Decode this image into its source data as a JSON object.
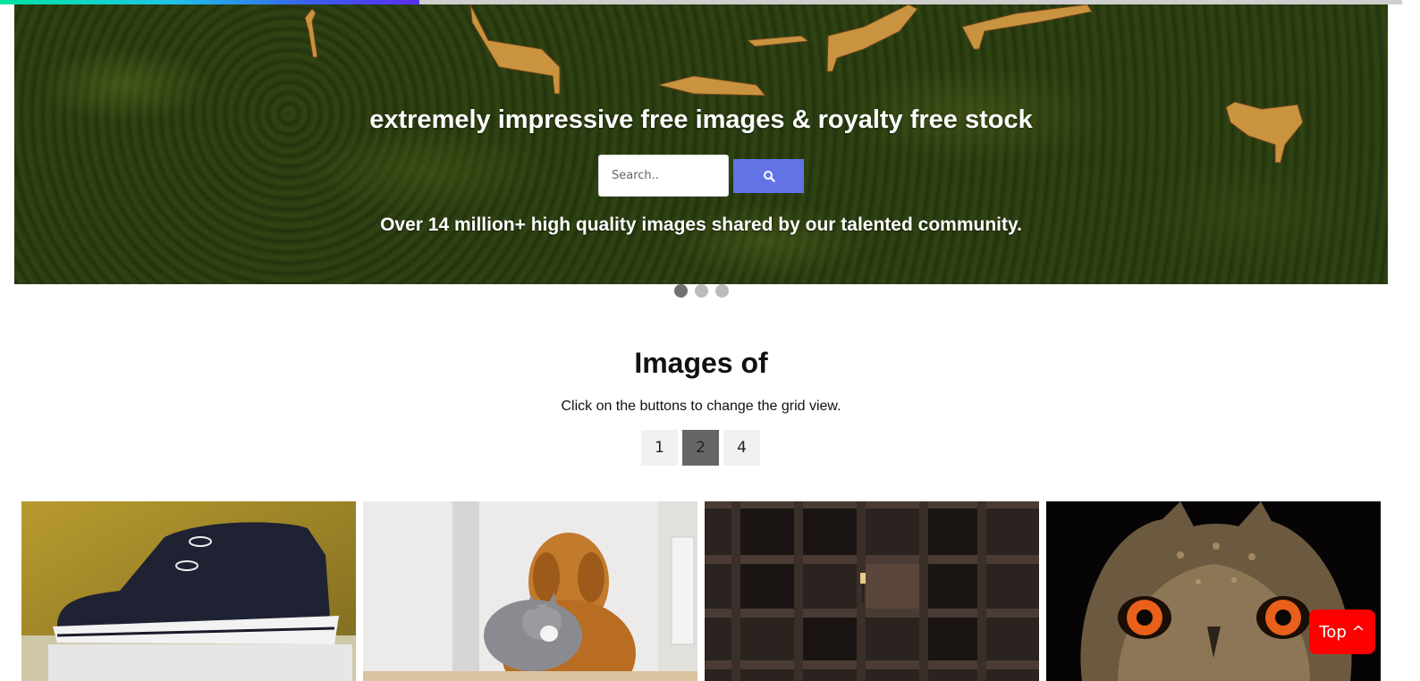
{
  "scroll_progress": {
    "fraction": 0.3,
    "colors": [
      "#00e5a0",
      "#1fc7e6",
      "#3a5cf0",
      "#5b2df2"
    ]
  },
  "hero": {
    "title": "extremely impressive free images & royalty free stock",
    "search_placeholder": "Search..",
    "search_icon": "search-icon",
    "subtitle": "Over 14 million+ high quality images shared by our talented community.",
    "slides": 3,
    "active_slide": 1
  },
  "section": {
    "title": "Images of",
    "description": "Click on the buttons to change the grid view.",
    "grid_buttons": [
      "1",
      "2",
      "4"
    ],
    "active_grid": "2"
  },
  "gallery": [
    "shoe",
    "cat-and-dog",
    "wooden-shelves",
    "owl"
  ],
  "top_button": "Top ^",
  "colors": {
    "accent": "#6373e6",
    "top_button": "#ff0000",
    "active_grid": "#666666"
  }
}
